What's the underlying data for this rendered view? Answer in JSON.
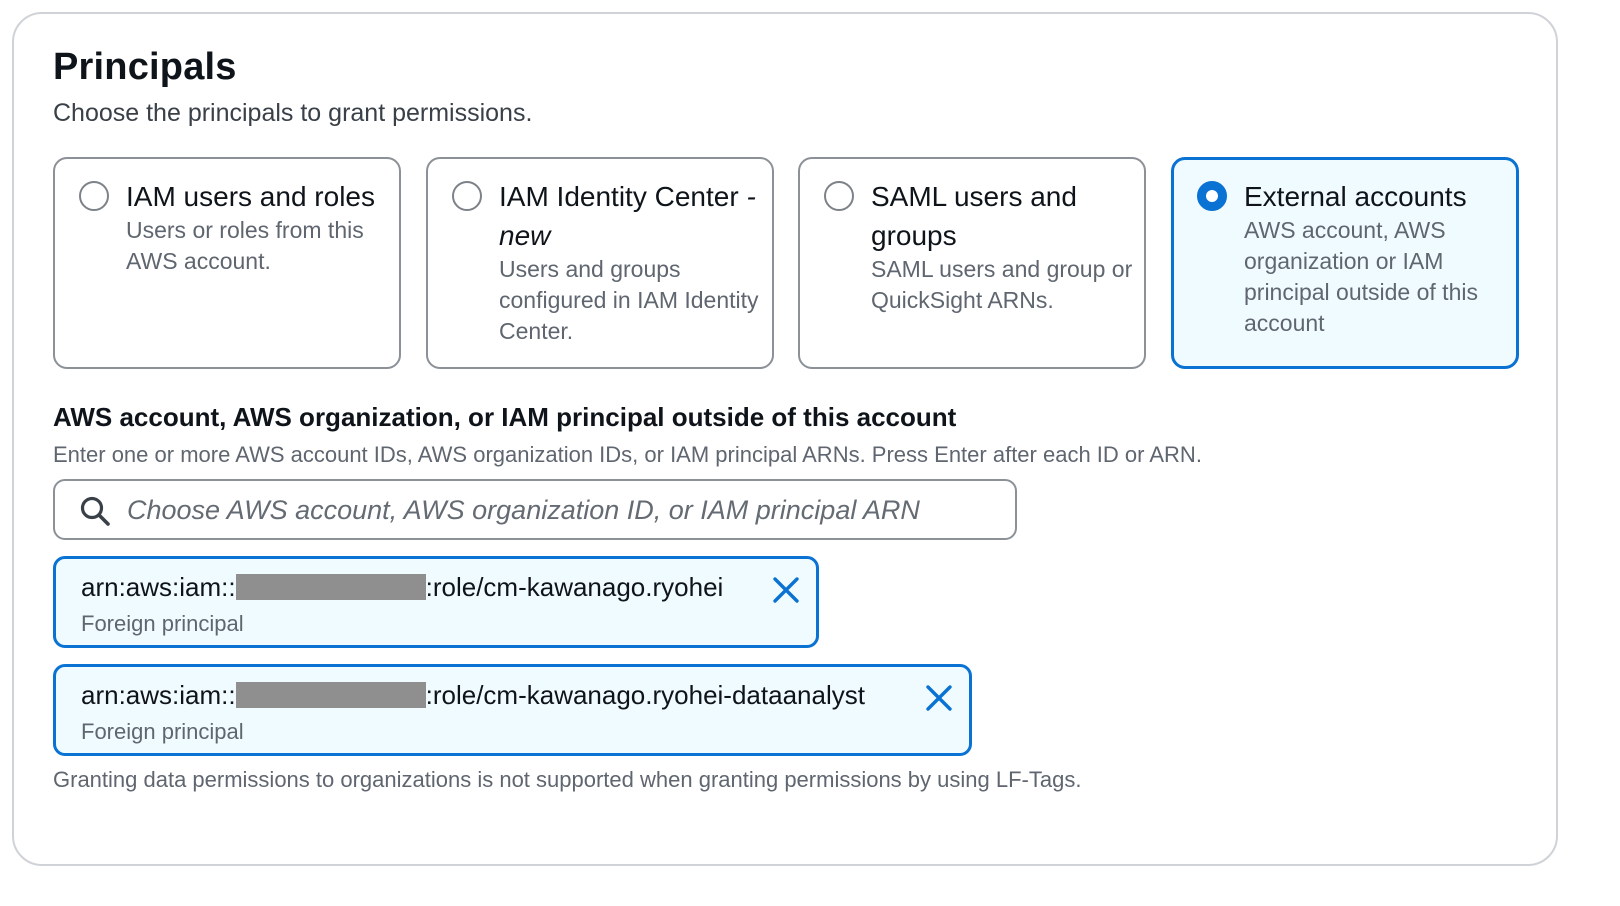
{
  "section": {
    "title": "Principals",
    "description": "Choose the principals to grant permissions."
  },
  "principal_types": [
    {
      "label": "IAM users and roles",
      "label_suffix": "",
      "description": "Users or roles from this AWS account.",
      "selected": false
    },
    {
      "label": "IAM Identity Center",
      "label_suffix": "- new",
      "description": "Users and groups configured in IAM Identity Center.",
      "selected": false
    },
    {
      "label": "SAML users and groups",
      "label_suffix": "",
      "description": "SAML users and group or QuickSight ARNs.",
      "selected": false
    },
    {
      "label": "External accounts",
      "label_suffix": "",
      "description": "AWS account, AWS organization or IAM principal outside of this account",
      "selected": true
    }
  ],
  "external": {
    "label": "AWS account, AWS organization, or IAM principal outside of this account",
    "description": "Enter one or more AWS account IDs, AWS organization IDs, or IAM principal ARNs. Press Enter after each ID or ARN.",
    "search": {
      "placeholder": "Choose AWS account, AWS organization ID, or IAM principal ARN",
      "value": ""
    },
    "tokens": [
      {
        "prefix": "arn:aws:iam::",
        "suffix": ":role/cm-kawanago.ryohei",
        "type": "Foreign principal"
      },
      {
        "prefix": "arn:aws:iam::",
        "suffix": ":role/cm-kawanago.ryohei-dataanalyst",
        "type": "Foreign principal"
      }
    ],
    "constraint": "Granting data permissions to organizations is not supported when granting permissions by using LF-Tags."
  },
  "colors": {
    "accent": "#0972d3",
    "selected_background": "#f0fbff",
    "border": "#8c9198",
    "redaction": "#8f8f8f"
  },
  "icons": {
    "search": "search-icon",
    "remove": "close-icon"
  }
}
